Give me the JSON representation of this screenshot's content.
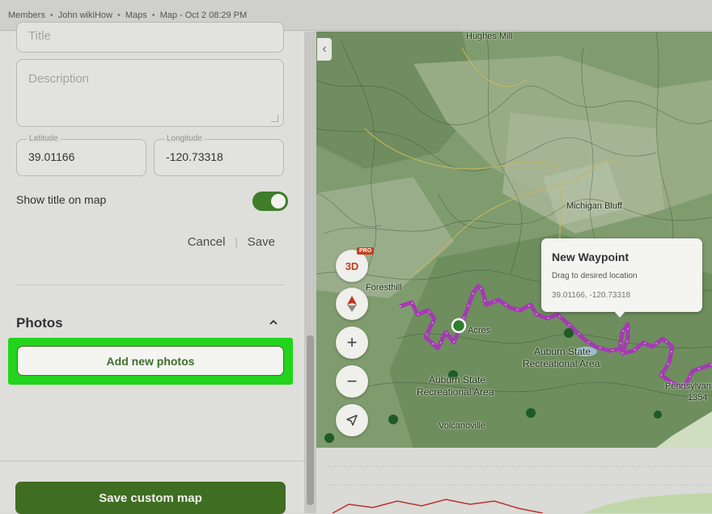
{
  "breadcrumb": [
    "Members",
    "John wikiHow",
    "Maps",
    "Map - Oct 2 08:29 PM"
  ],
  "form": {
    "title_placeholder": "Title",
    "description_placeholder": "Description",
    "latitude_label": "Latitude",
    "latitude_value": "39.01166",
    "longitude_label": "Longitude",
    "longitude_value": "-120.73318",
    "show_title_label": "Show title on map",
    "show_title_on": true,
    "cancel_label": "Cancel",
    "divider": "|",
    "save_label": "Save"
  },
  "photos": {
    "heading": "Photos",
    "add_button": "Add new photos"
  },
  "save_map_button": "Save custom map",
  "map": {
    "controls": {
      "three_d": "3D",
      "pro_badge": "PRO",
      "zoom_in": "+",
      "zoom_out": "−"
    },
    "popup": {
      "title": "New Waypoint",
      "subtitle": "Drag to desired location",
      "coords": "39.01166, -120.73318"
    },
    "labels": {
      "hughes_mill": "Hughes Mill",
      "michigan_bluff": "Michigan Bluff",
      "foresthill": "Foresthill",
      "acres": "Acres",
      "auburn_1a": "Auburn State",
      "auburn_1b": "Recreational Area",
      "auburn_2a": "Auburn State",
      "auburn_2b": "Recreational Area",
      "volcanoville": "Volcanoville",
      "pennyslvania": "Pennsylvania",
      "pennyslvania_2": "1354"
    },
    "colors": {
      "trail": "#a53ab3",
      "accent": "#3f6d22",
      "highlight": "#22d41c"
    }
  }
}
